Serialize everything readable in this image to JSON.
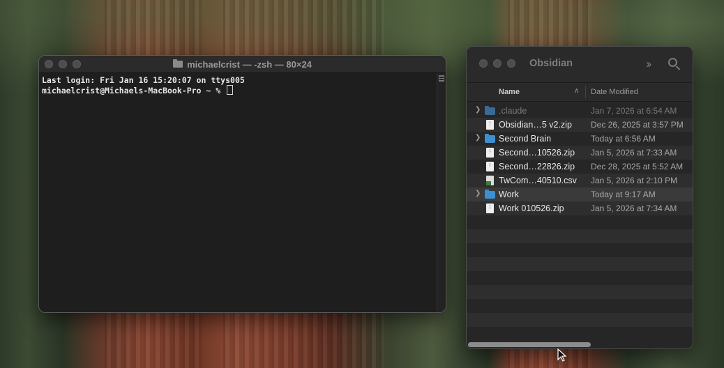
{
  "terminal": {
    "title": "michaelcrist — -zsh — 80×24",
    "line1": "Last login: Fri Jan 16 15:20:07 on ttys005",
    "prompt": "michaelcrist@Michaels-MacBook-Pro ~ % "
  },
  "finder": {
    "title": "Obsidian",
    "columns": {
      "name": "Name",
      "date": "Date Modified"
    },
    "rows": [
      {
        "name": ".claude",
        "date": "Jan 7, 2026 at 6:54 AM",
        "kind": "folder",
        "expandable": true,
        "dim": true
      },
      {
        "name": "Obsidian…5 v2.zip",
        "date": "Dec 26, 2025 at 3:57 PM",
        "kind": "doc",
        "expandable": false,
        "dim": false
      },
      {
        "name": "Second Brain",
        "date": "Today at 6:56 AM",
        "kind": "folder",
        "expandable": true,
        "dim": false
      },
      {
        "name": "Second…10526.zip",
        "date": "Jan 5, 2026 at 7:33 AM",
        "kind": "doc",
        "expandable": false,
        "dim": false
      },
      {
        "name": "Second…22826.zip",
        "date": "Dec 28, 2025 at 5:52 AM",
        "kind": "doc",
        "expandable": false,
        "dim": false
      },
      {
        "name": "TwCom…40510.csv",
        "date": "Jan 5, 2026 at 2:10 PM",
        "kind": "csv",
        "expandable": false,
        "dim": false
      },
      {
        "name": "Work",
        "date": "Today at 9:17 AM",
        "kind": "folder",
        "expandable": true,
        "dim": false,
        "highlight": true
      },
      {
        "name": "Work 010526.zip",
        "date": "Jan 5, 2026 at 7:34 AM",
        "kind": "doc",
        "expandable": false,
        "dim": false
      }
    ]
  }
}
